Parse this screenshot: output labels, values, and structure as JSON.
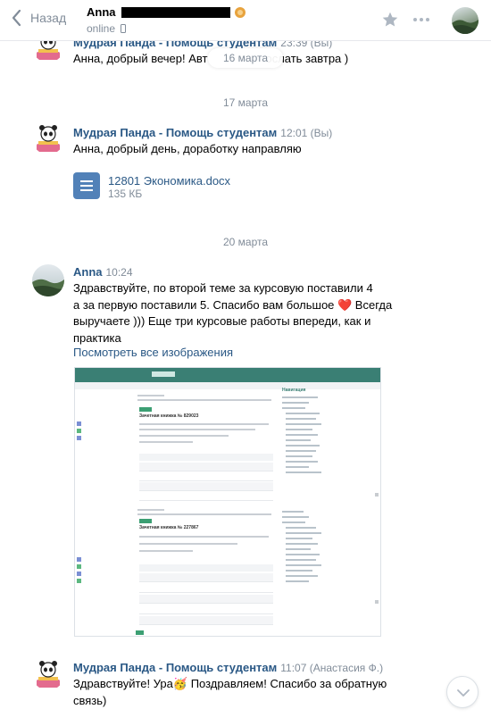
{
  "header": {
    "back_label": "Назад",
    "peer_name": "Anna",
    "peer_status": "online"
  },
  "date_float": "16 марта",
  "messages": [
    {
      "author": "Мудрая Панда - Помощь студентам",
      "time": "23:39 (Вы)",
      "text": "Анна, добрый вечер! Авт                  ослать завтра )"
    },
    {
      "date": "17 марта",
      "author": "Мудрая Панда - Помощь студентам",
      "time": "12:01 (Вы)",
      "text": "Анна, добрый день, доработку направляю",
      "attachment": {
        "name": "12801 Экономика.docx",
        "size": "135 КБ"
      }
    },
    {
      "date": "20 марта",
      "author": "Anna",
      "time": "10:24",
      "text_lines": [
        "Здравствуйте, по второй теме за курсовую поставили 4",
        "а за первую поставили 5. Спасибо вам большое ❤️ Всегда",
        "выручаете ))) Еще три курсовые работы впереди, как и",
        "практика"
      ],
      "link": "Посмотреть все изображения",
      "image": {
        "top_heading": "Зачетная книжка № 829023",
        "bottom_heading": "Зачетная книжка № 227867",
        "nav_title": "Навигация"
      }
    },
    {
      "author": "Мудрая Панда - Помощь студентам",
      "time": "11:07 (Анастасия Ф.)",
      "text_lines": [
        "Здравствуйте! Ура🥳 Поздравляем! Спасибо за обратную",
        "связь)"
      ]
    }
  ],
  "colors": {
    "link": "#2a5885",
    "muted": "#818c99",
    "doc_icon": "#5181b8",
    "heart": "#e64646"
  }
}
